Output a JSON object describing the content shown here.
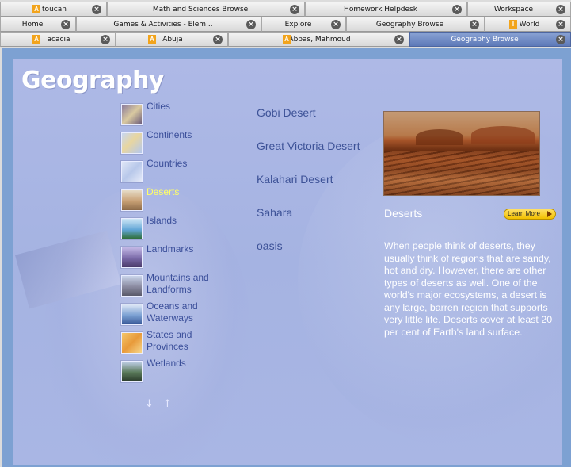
{
  "tabs": {
    "row1": [
      {
        "label": "toucan",
        "has_a_icon": true
      },
      {
        "label": "Math and Sciences Browse"
      },
      {
        "label": "Homework Helpdesk"
      },
      {
        "label": "Workspace"
      }
    ],
    "row2": [
      {
        "label": "Home"
      },
      {
        "label": "Games & Activities - Elem..."
      },
      {
        "label": "Explore"
      },
      {
        "label": "Geography Browse"
      },
      {
        "label": "World",
        "has_i_icon": true
      }
    ],
    "row3": [
      {
        "label": "acacia",
        "has_a_icon": true
      },
      {
        "label": "Abuja",
        "has_a_icon": true
      },
      {
        "label": "Abbas, Mahmoud",
        "has_a_icon": true
      },
      {
        "label": "Geography Browse",
        "active": true
      }
    ]
  },
  "page": {
    "title": "Geography"
  },
  "categories": [
    {
      "label": "Cities",
      "icon": "cities-thumb-icon"
    },
    {
      "label": "Continents",
      "icon": "continents-thumb-icon"
    },
    {
      "label": "Countries",
      "icon": "countries-thumb-icon"
    },
    {
      "label": "Deserts",
      "icon": "deserts-thumb-icon",
      "selected": true
    },
    {
      "label": "Islands",
      "icon": "islands-thumb-icon"
    },
    {
      "label": "Landmarks",
      "icon": "landmarks-thumb-icon"
    },
    {
      "label": "Mountains and Landforms",
      "icon": "mountains-thumb-icon"
    },
    {
      "label": "Oceans and Waterways",
      "icon": "oceans-thumb-icon"
    },
    {
      "label": "States and Provinces",
      "icon": "states-thumb-icon"
    },
    {
      "label": "Wetlands",
      "icon": "wetlands-thumb-icon"
    }
  ],
  "scroll_arrows": {
    "down": "↓",
    "up": "↑"
  },
  "desert_links": [
    "Gobi Desert",
    "Great Victoria Desert",
    "Kalahari Desert",
    "Sahara",
    "oasis"
  ],
  "detail": {
    "title": "Deserts",
    "learn_more": "Learn More",
    "description": "When people think of deserts, they usually think of regions that are sandy, hot and dry. However, there are other types of deserts as well. One of the world's major ecosystems, a desert is any large, barren region that supports very little life. Deserts cover at least 20 per cent of Earth's land surface."
  },
  "colors": {
    "panel_bg": "#aab6e3",
    "frame_bg": "#7da1d2",
    "link_text": "#3d5297",
    "selected_text": "#ffff66",
    "active_tab": "#6e88c4"
  }
}
